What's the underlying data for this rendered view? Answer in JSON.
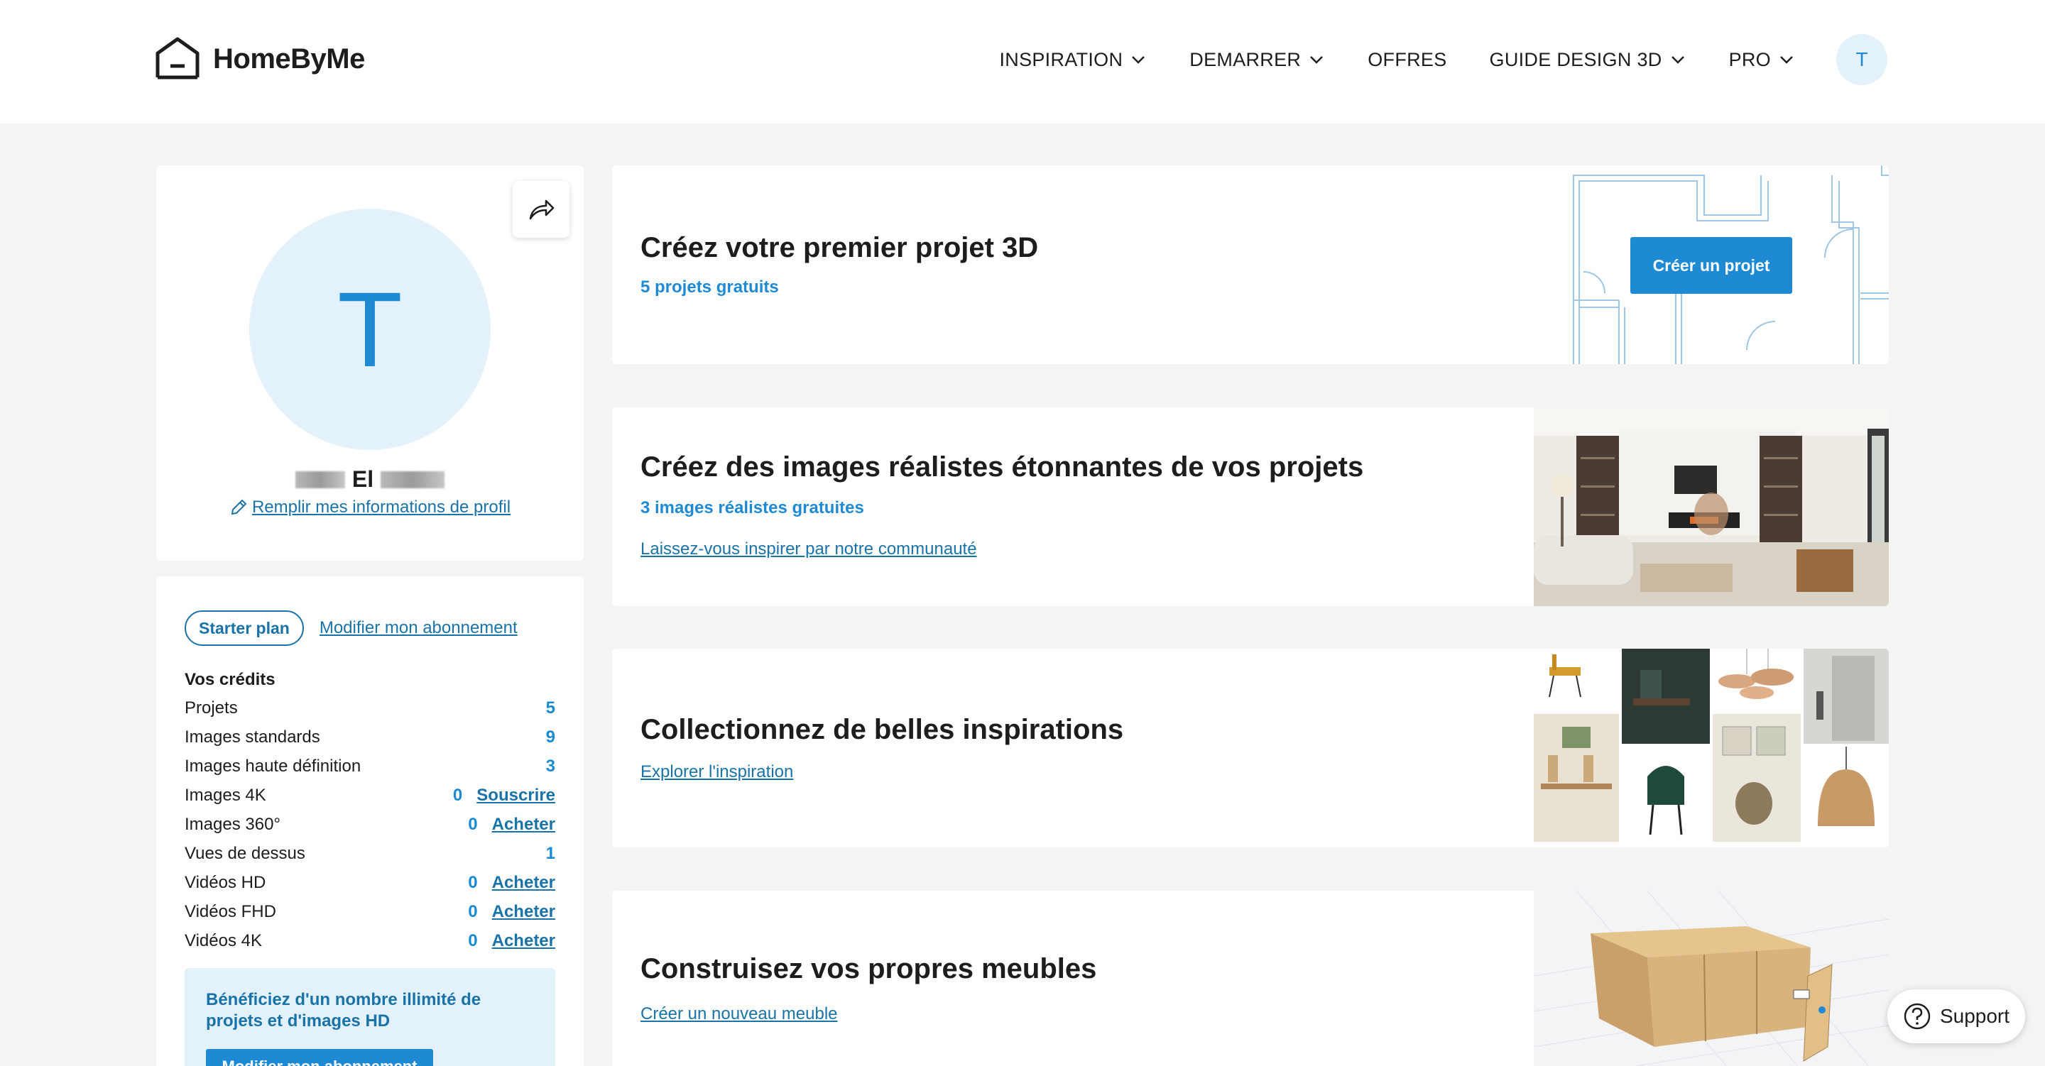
{
  "header": {
    "logo_text": "HomeByMe",
    "nav": [
      {
        "label": "INSPIRATION",
        "dropdown": true
      },
      {
        "label": "DEMARRER",
        "dropdown": true
      },
      {
        "label": "OFFRES",
        "dropdown": false
      },
      {
        "label": "GUIDE DESIGN 3D",
        "dropdown": true
      },
      {
        "label": "PRO",
        "dropdown": true
      }
    ],
    "avatar_initial": "T"
  },
  "profile": {
    "avatar_initial": "T",
    "name_visible": "El",
    "edit_link": "Remplir mes informations de profil"
  },
  "credits": {
    "plan_label": "Starter plan",
    "modify_link": "Modifier mon abonnement",
    "title": "Vos crédits",
    "rows": [
      {
        "label": "Projets",
        "value": "5",
        "action": ""
      },
      {
        "label": "Images standards",
        "value": "9",
        "action": ""
      },
      {
        "label": "Images haute définition",
        "value": "3",
        "action": ""
      },
      {
        "label": "Images 4K",
        "value": "0",
        "action": "Souscrire"
      },
      {
        "label": "Images 360°",
        "value": "0",
        "action": "Acheter"
      },
      {
        "label": "Vues de dessus",
        "value": "1",
        "action": ""
      },
      {
        "label": "Vidéos HD",
        "value": "0",
        "action": "Acheter"
      },
      {
        "label": "Vidéos FHD",
        "value": "0",
        "action": "Acheter"
      },
      {
        "label": "Vidéos 4K",
        "value": "0",
        "action": "Acheter"
      }
    ],
    "promo_text": "Bénéficiez d'un nombre illimité de projets et d'images HD",
    "promo_button": "Modifier mon abonnement"
  },
  "cards": {
    "project": {
      "title": "Créez votre premier projet 3D",
      "subtitle": "5 projets gratuits",
      "button": "Créer un projet"
    },
    "images": {
      "title": "Créez des images réalistes étonnantes de vos projets",
      "subtitle": "3 images réalistes gratuites",
      "link": "Laissez-vous inspirer par notre communauté"
    },
    "inspiration": {
      "title": "Collectionnez de belles inspirations",
      "link": "Explorer l'inspiration"
    },
    "furniture": {
      "title": "Construisez vos propres meubles",
      "link": "Créer un nouveau meuble"
    }
  },
  "support_label": "Support",
  "colors": {
    "accent": "#1e8ad4",
    "link": "#1a73a8",
    "light_blue": "#e3f1fa",
    "background": "#f4f4f4"
  }
}
